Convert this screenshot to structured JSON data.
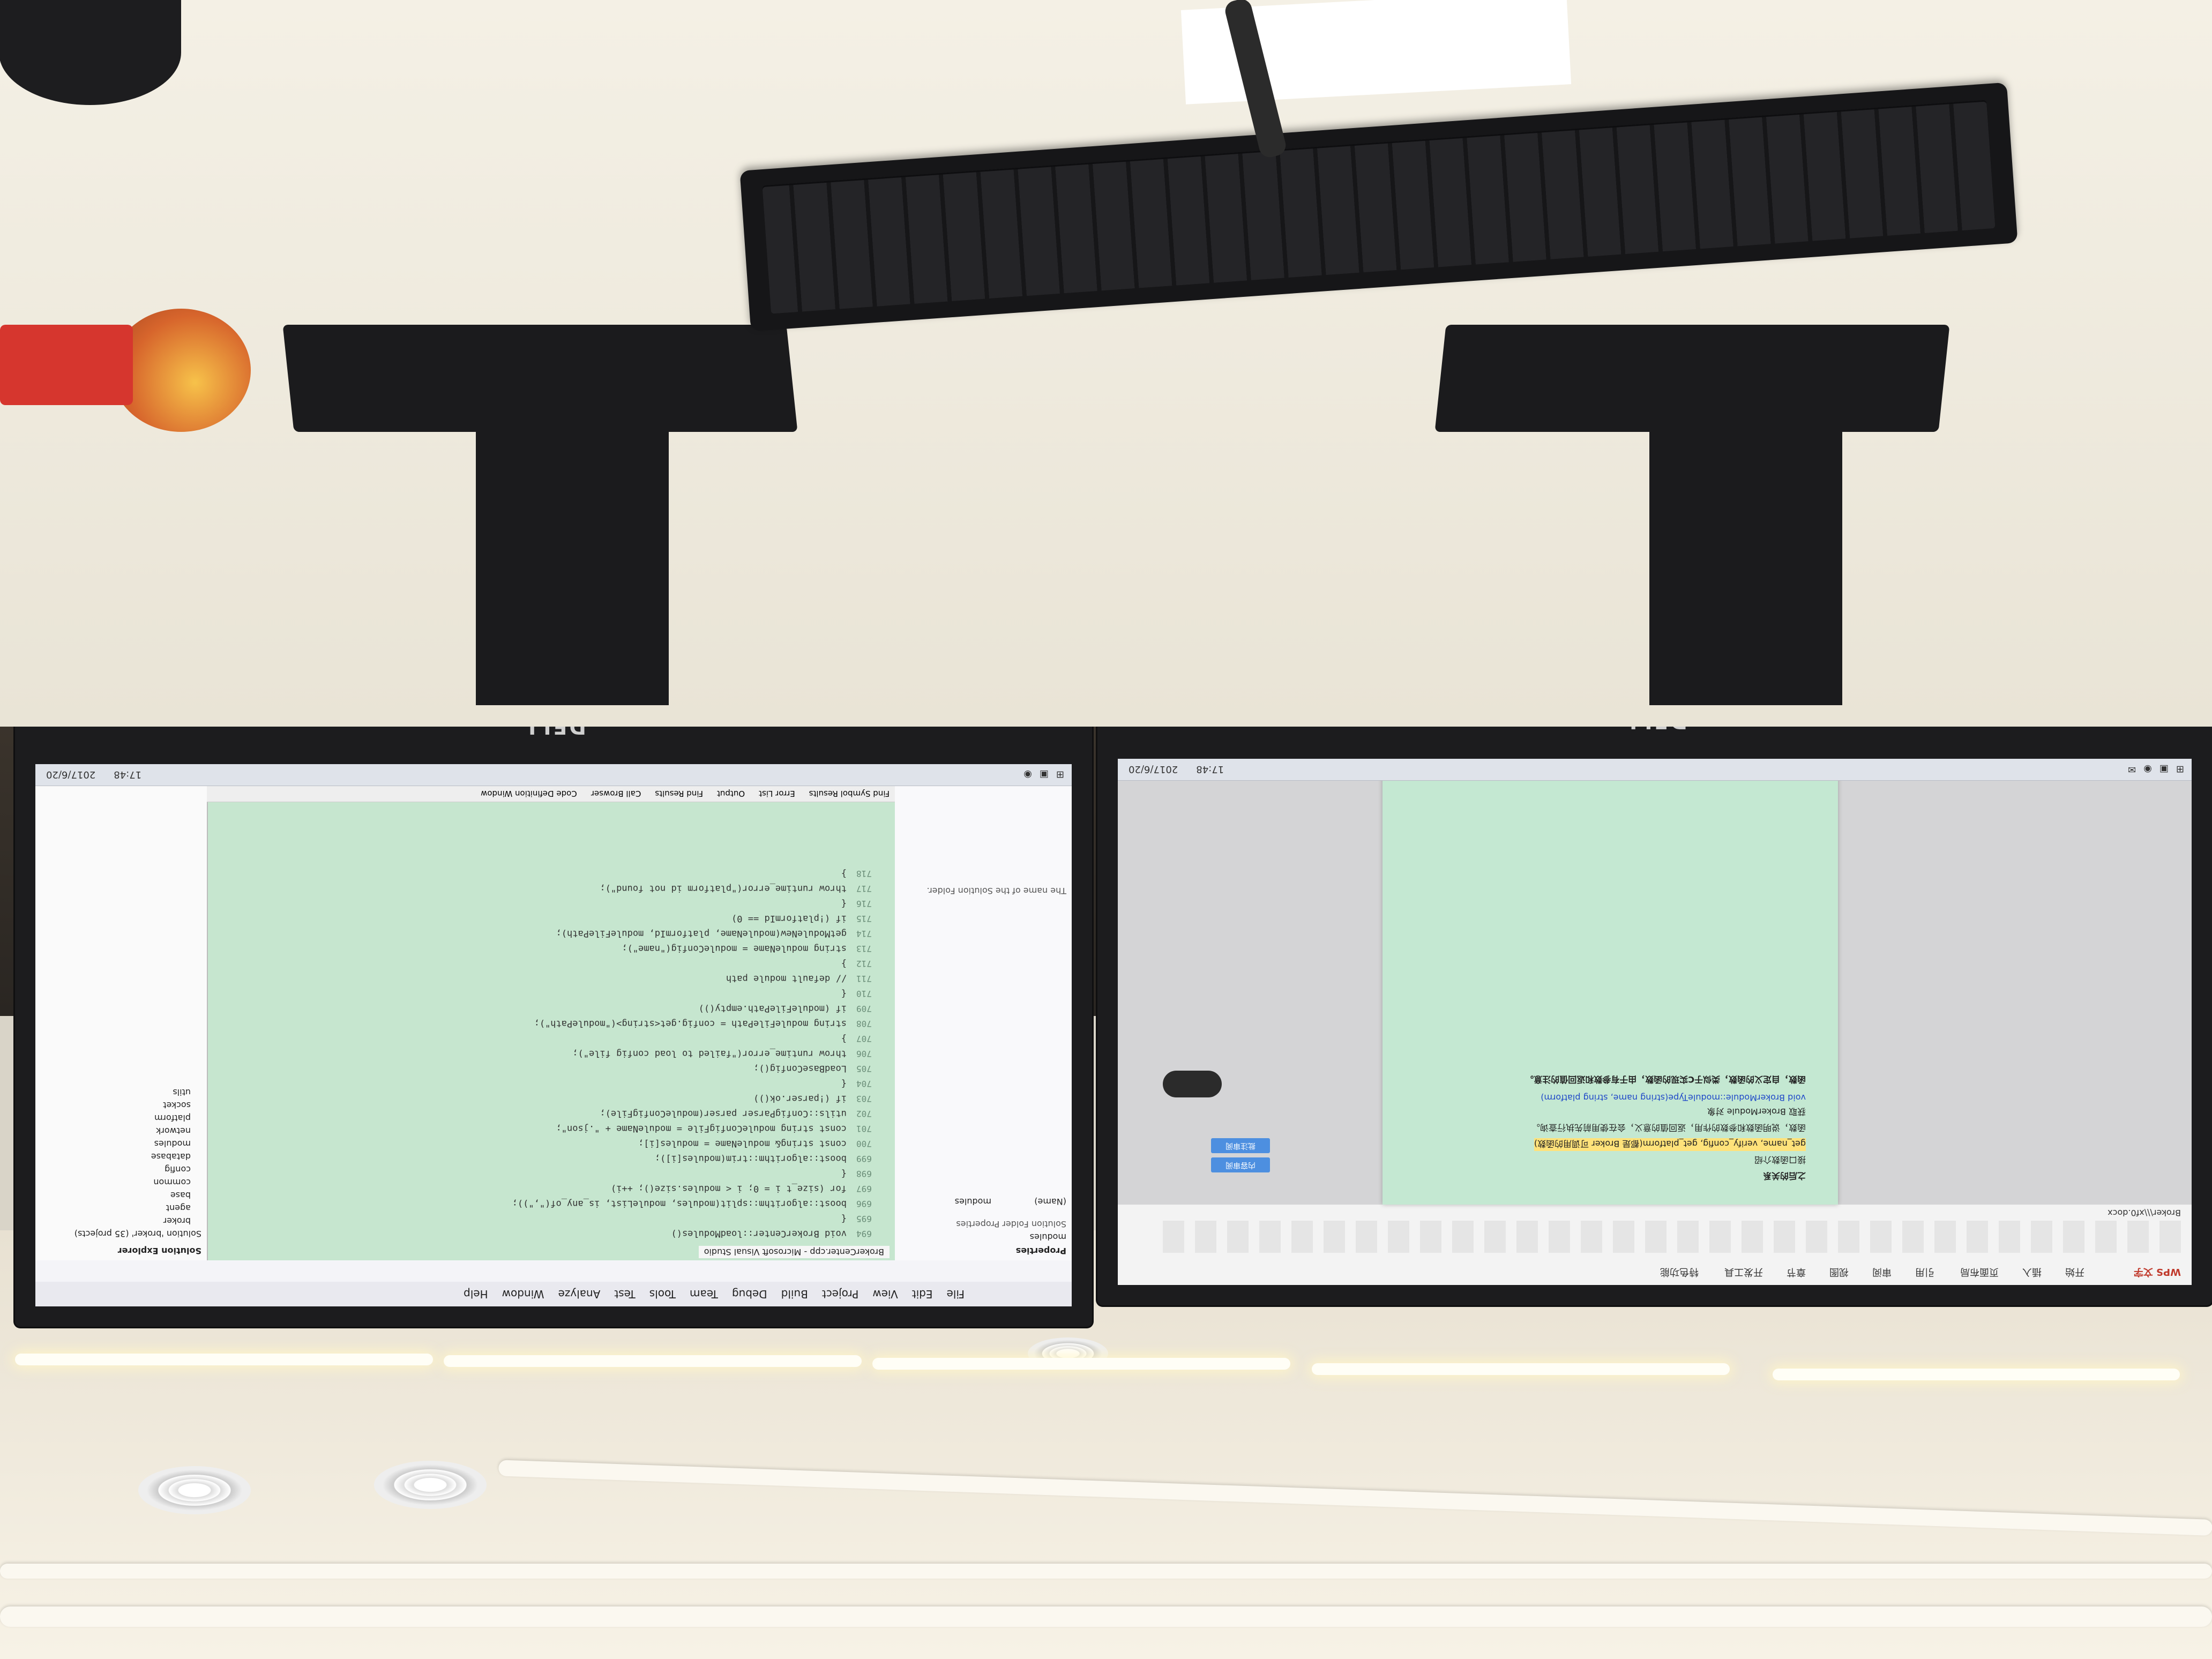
{
  "photo": {
    "orientation": "upside-down",
    "description_items": [
      "ceiling",
      "monitors",
      "desk",
      "keyboard",
      "apple"
    ]
  },
  "left_monitor": {
    "brand": "DELL",
    "app": {
      "title": "BrokerCenter.cpp - Microsoft Visual Studio",
      "menu": [
        "File",
        "Edit",
        "View",
        "Project",
        "Build",
        "Debug",
        "Team",
        "Tools",
        "Test",
        "Analyze",
        "Window",
        "Help"
      ],
      "solution_explorer_title": "Solution Explorer",
      "solution_items": [
        "Solution 'broker' (35 projects)",
        "broker",
        "agent",
        "base",
        "common",
        "config",
        "database",
        "modules",
        "network",
        "platform",
        "socket",
        "utils"
      ],
      "properties_title": "Properties",
      "properties_selected": "modules",
      "properties_caption": "Solution Folder Properties",
      "properties_name_label": "(Name)",
      "properties_name_value": "modules",
      "properties_help": "The name of the Solution Folder.",
      "output_tabs": [
        "Find Symbol Results",
        "Error List",
        "Output",
        "Find Results",
        "Call Browser",
        "Code Definition Window"
      ],
      "status_time": "17:48",
      "status_date": "2017/6/20",
      "line_numbers": [
        "694",
        "695",
        "696",
        "697",
        "698",
        "699",
        "700",
        "701",
        "702",
        "703",
        "704",
        "705",
        "706",
        "707",
        "708",
        "709",
        "710",
        "711",
        "712",
        "713",
        "714",
        "715",
        "716",
        "717",
        "718"
      ],
      "code_lines": [
        "void BrokerCenter::loadModules()",
        "{",
        "    boost::algorithm::split(modules, moduleList, is_any_of(\",\"));",
        "    for (size_t i = 0; i < modules.size(); ++i)",
        "    {",
        "        boost::algorithm::trim(modules[i]);",
        "        const string& moduleName = modules[i];",
        "        const string moduleConfigFile = moduleName + \".json\";",
        "        utils::ConfigParser parser(moduleConfigFile);",
        "        if (!parser.ok())",
        "        {",
        "            LoadBaseConfig();",
        "            throw runtime_error(\"failed to load config file\");",
        "        }",
        "        string moduleFilePath = config.get<string>(\"modulePath\");",
        "        if (moduleFilePath.empty())",
        "        {",
        "            // default module path",
        "        }",
        "        string moduleName = moduleConfig(\"name\");",
        "        getModuleNew(moduleName, platformId, moduleFilePath);",
        "        if (!platformId == 0)",
        "        {",
        "            throw runtime_error(\"platform id not found\");",
        "        }"
      ]
    }
  },
  "right_monitor": {
    "brand": "DELL",
    "app": {
      "title": "WPS 文字",
      "document_name": "Broker\\\\\\xf0.docx",
      "tabs": [
        "开始",
        "插入",
        "页面布局",
        "引用",
        "审阅",
        "视图",
        "章节",
        "开发工具",
        "特色功能"
      ],
      "status_time": "17:48",
      "status_date": "2017/6/20",
      "doc_lines": [
        "之后的关系",
        "接口函数介绍",
        "get_name, verify_config, get_platform(都是 Broker 可调用的函数)",
        "函数，说明函数和参数的作用，返回值的意义，会在使用前先执行查询。",
        "获取 BrokerModule 对象",
        "void BrokerModule::moduleType(string name, string platform)",
        "函数，自定义的函数，类似于C实现的函数，由于有参数和返回值的注意。"
      ],
      "side_buttons": [
        "内容审阅",
        "批注审阅"
      ]
    }
  }
}
